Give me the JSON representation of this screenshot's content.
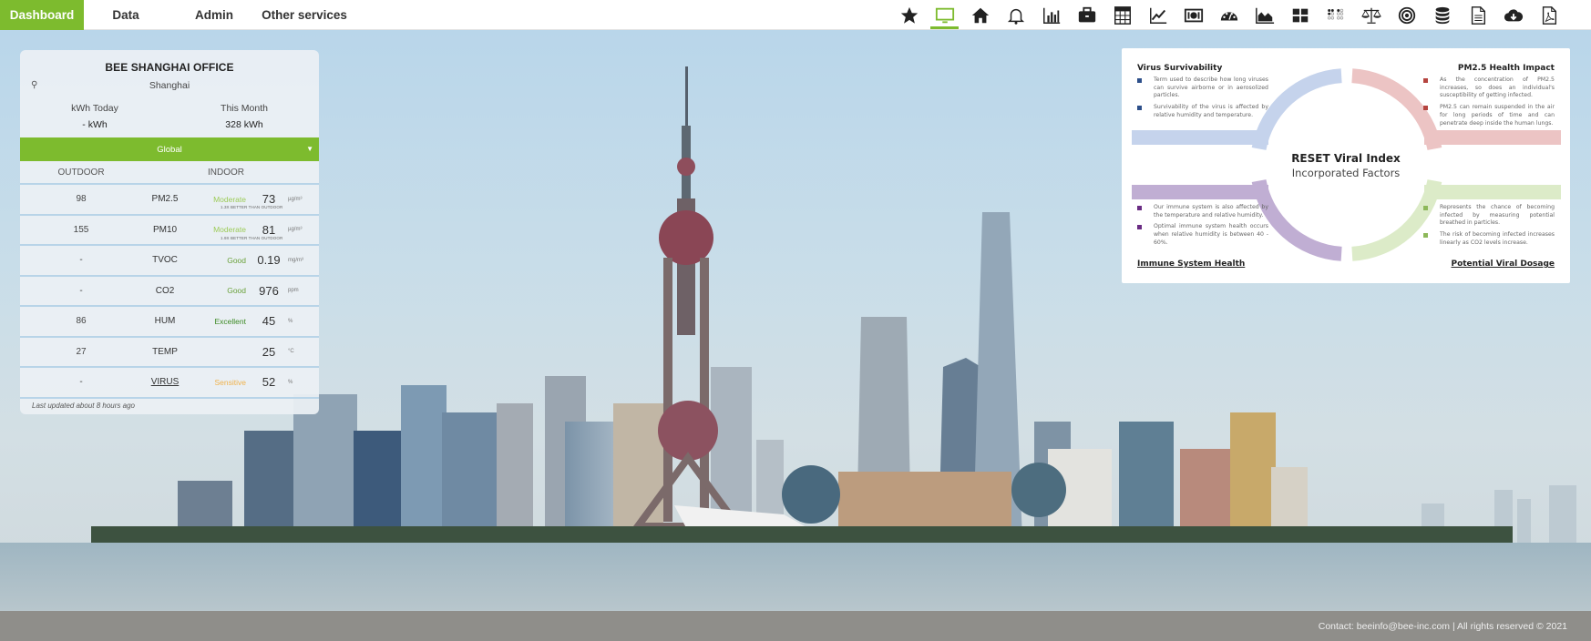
{
  "nav": {
    "tabs": [
      {
        "label": "Dashboard",
        "active": true
      },
      {
        "label": "Data",
        "active": false
      },
      {
        "label": "Admin",
        "active": false
      },
      {
        "label": "Other services",
        "active": false
      }
    ],
    "icons": [
      {
        "name": "star-icon",
        "active": false
      },
      {
        "name": "monitor-icon",
        "active": true
      },
      {
        "name": "home-icon",
        "active": false
      },
      {
        "name": "bell-icon",
        "active": false
      },
      {
        "name": "bar-chart-icon",
        "active": false
      },
      {
        "name": "briefcase-icon",
        "active": false
      },
      {
        "name": "calculator-icon",
        "active": false
      },
      {
        "name": "line-chart-icon",
        "active": false
      },
      {
        "name": "money-icon",
        "active": false
      },
      {
        "name": "gauge-icon",
        "active": false
      },
      {
        "name": "area-chart-icon",
        "active": false
      },
      {
        "name": "grid-icon",
        "active": false
      },
      {
        "name": "dots-grid-icon",
        "active": false
      },
      {
        "name": "balance-scale-icon",
        "active": false
      },
      {
        "name": "target-icon",
        "active": false
      },
      {
        "name": "database-icon",
        "active": false
      },
      {
        "name": "document-icon",
        "active": false
      },
      {
        "name": "cloud-download-icon",
        "active": false
      },
      {
        "name": "pdf-icon",
        "active": false
      }
    ],
    "accent_color": "#7dbb2e"
  },
  "card": {
    "office": "BEE SHANGHAI OFFICE",
    "location": "Shanghai",
    "kwh_today_label": "kWh Today",
    "kwh_today_value": "- kWh",
    "this_month_label": "This Month",
    "this_month_value": "328 kWh",
    "scope_selector": "Global",
    "outdoor_header": "OUTDOOR",
    "indoor_header": "INDOOR",
    "metrics": [
      {
        "outdoor": "98",
        "name": "PM2.5",
        "status": "Moderate",
        "status_class": "st-moderate",
        "value": "73",
        "unit": "µg/m³",
        "sub": "1.3X BETTER THAN OUTDOOR",
        "link": false
      },
      {
        "outdoor": "155",
        "name": "PM10",
        "status": "Moderate",
        "status_class": "st-moderate",
        "value": "81",
        "unit": "µg/m³",
        "sub": "1.9X BETTER THAN OUTDOOR",
        "link": false
      },
      {
        "outdoor": "-",
        "name": "TVOC",
        "status": "Good",
        "status_class": "st-good",
        "value": "0.19",
        "unit": "mg/m³",
        "sub": "",
        "link": false
      },
      {
        "outdoor": "-",
        "name": "CO2",
        "status": "Good",
        "status_class": "st-good",
        "value": "976",
        "unit": "ppm",
        "sub": "",
        "link": false
      },
      {
        "outdoor": "86",
        "name": "HUM",
        "status": "Excellent",
        "status_class": "st-excellent",
        "value": "45",
        "unit": "%",
        "sub": "",
        "link": false
      },
      {
        "outdoor": "27",
        "name": "TEMP",
        "status": "",
        "status_class": "",
        "value": "25",
        "unit": "°C",
        "sub": "",
        "link": false
      },
      {
        "outdoor": "-",
        "name": "VIRUS",
        "status": "Sensitive",
        "status_class": "st-sensitive",
        "value": "52",
        "unit": "%",
        "sub": "",
        "link": true
      }
    ],
    "last_updated": "Last updated about 8 hours ago"
  },
  "infographic": {
    "center_title": "RESET Viral Index",
    "center_subtitle": "Incorporated Factors",
    "quadrants": [
      {
        "title": "Virus Survivability",
        "color": "#c5d3ec",
        "bullet_color": "#2d4f8a",
        "bullets": [
          "Term used to describe how long viruses can survive airborne or in aerosolized particles.",
          "Survivability of the virus is affected by relative humidity and temperature."
        ]
      },
      {
        "title": "PM2.5 Health Impact",
        "color": "#ecc4c4",
        "bullet_color": "#b5443f",
        "bullets": [
          "As the concentration of PM2.5 increases, so does an individual's susceptibility of getting infected.",
          "PM2.5 can remain suspended in the air for long periods of time and can penetrate deep inside the human lungs."
        ]
      },
      {
        "title": "Immune System Health",
        "color": "#c0aed3",
        "bullet_color": "#6a2c83",
        "bullets": [
          "Our immune system is also affected by the temperature and relative humidity.",
          "Optimal immune system health occurs when relative humidity is between 40 - 60%."
        ]
      },
      {
        "title": "Potential Viral Dosage",
        "color": "#dcebc8",
        "bullet_color": "#8db85a",
        "bullets": [
          "Represents the chance of becoming infected by measuring potential breathed in particles.",
          "The risk of becoming infected increases linearly as CO2 levels increase."
        ]
      }
    ]
  },
  "footer": {
    "text": "Contact: beeinfo@bee-inc.com | All rights reserved © 2021"
  }
}
